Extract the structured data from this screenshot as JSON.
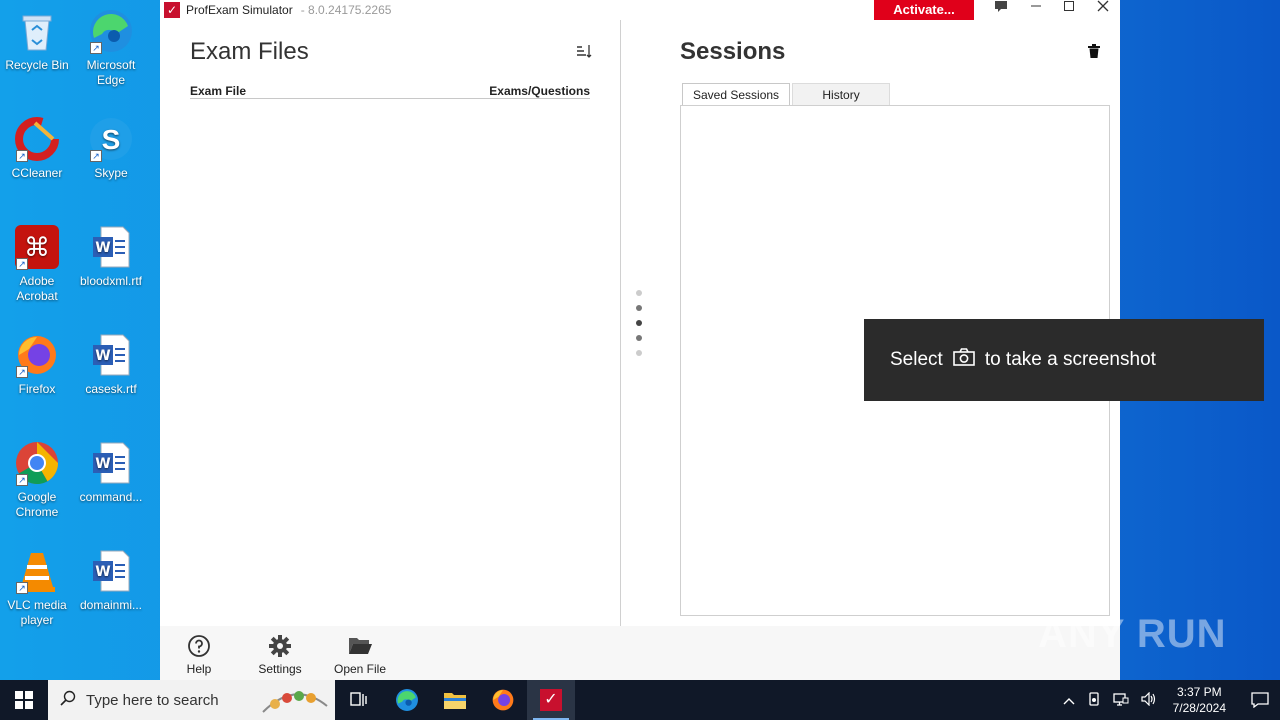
{
  "desktop": {
    "icons": [
      {
        "label": "Recycle Bin"
      },
      {
        "label": "Microsoft Edge"
      },
      {
        "label": "CCleaner"
      },
      {
        "label": "Skype"
      },
      {
        "label": "Adobe Acrobat"
      },
      {
        "label": "bloodxml.rtf"
      },
      {
        "label": "Firefox"
      },
      {
        "label": "casesk.rtf"
      },
      {
        "label": "Google Chrome"
      },
      {
        "label": "command..."
      },
      {
        "label": "VLC media player"
      },
      {
        "label": "domainmi..."
      }
    ]
  },
  "app": {
    "title": "ProfExam Simulator",
    "version": "- 8.0.24175.2265",
    "activate_label": "Activate..."
  },
  "exam_files": {
    "title": "Exam Files",
    "columns": [
      "Exam File",
      "Exams/Questions"
    ]
  },
  "sessions": {
    "title": "Sessions",
    "tabs": [
      {
        "label": "Saved Sessions",
        "active": true
      },
      {
        "label": "History",
        "active": false
      }
    ]
  },
  "bottombar": {
    "help_label": "Help",
    "settings_label": "Settings",
    "open_file_label": "Open File"
  },
  "toast": {
    "select": "Select",
    "rest": "to take a screenshot"
  },
  "watermark": "ANY RUN",
  "taskbar": {
    "search_placeholder": "Type here to search",
    "time": "3:37 PM",
    "date": "7/28/2024"
  },
  "colors": {
    "accent_red": "#e0001a",
    "taskbar_bg": "#101828",
    "desktop_blue": "#1496e8"
  }
}
